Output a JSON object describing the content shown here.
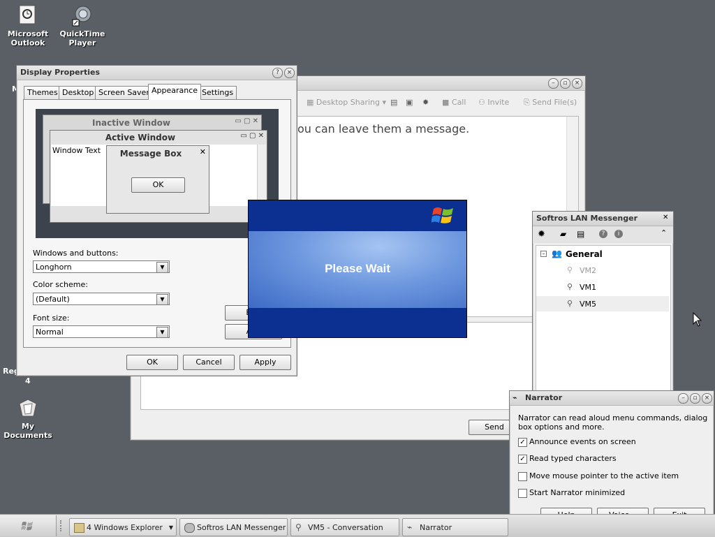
{
  "desktop": {
    "icons": [
      {
        "label": "Microsoft Outlook",
        "icon": "outlook-icon"
      },
      {
        "label": "QuickTime Player",
        "icon": "quicktime-icon"
      },
      {
        "label": "My Documents",
        "icon": "my-documents-icon"
      }
    ],
    "partial_labels": {
      "reg": "Reg",
      "four": "4",
      "m": "M"
    }
  },
  "display_properties": {
    "title": "Display Properties",
    "tabs": [
      "Themes",
      "Desktop",
      "Screen Saver",
      "Appearance",
      "Settings"
    ],
    "active_tab": "Appearance",
    "preview": {
      "inactive_title": "Inactive Window",
      "active_title": "Active Window",
      "window_text": "Window Text",
      "msgbox_title": "Message Box",
      "msgbox_ok": "OK"
    },
    "windows_buttons_label": "Windows and buttons:",
    "windows_buttons_value": "Longhorn",
    "color_scheme_label": "Color scheme:",
    "color_scheme_value": "(Default)",
    "font_size_label": "Font size:",
    "font_size_value": "Normal",
    "effects_label": "Effe",
    "advanced_label": "Adv",
    "ok": "OK",
    "cancel": "Cancel",
    "apply": "Apply"
  },
  "conversation": {
    "toolbar": [
      "Desktop Sharing",
      "Call",
      "Invite",
      "Send File(s)"
    ],
    "message": "ou can leave them a message.",
    "send": "Send"
  },
  "please_wait": {
    "text": "Please Wait",
    "colors": {
      "band": "#0c2f92",
      "center": "#5b86d8"
    }
  },
  "lan_messenger": {
    "title": "Softros LAN Messenger",
    "group": "General",
    "users": [
      {
        "name": "VM2",
        "online": false
      },
      {
        "name": "VM1",
        "online": true
      },
      {
        "name": "VM5",
        "online": true
      }
    ]
  },
  "narrator": {
    "title": "Narrator",
    "description": "Narrator can read aloud menu commands, dialog box options and more.",
    "options": [
      {
        "label": "Announce events on screen",
        "checked": true
      },
      {
        "label": "Read typed characters",
        "checked": true
      },
      {
        "label": "Move mouse pointer to the active item",
        "checked": false
      },
      {
        "label": "Start Narrator minimized",
        "checked": false
      }
    ],
    "help": "Help",
    "voice": "Voice...",
    "exit": "Exit"
  },
  "taskbar": {
    "items": [
      {
        "label": "4 Windows Explorer",
        "icon": "folder-icon"
      },
      {
        "label": "Softros LAN Messenger",
        "icon": "messenger-icon"
      },
      {
        "label": "VM5 - Conversation",
        "icon": "user-icon"
      },
      {
        "label": "Narrator",
        "icon": "narrator-icon"
      }
    ]
  }
}
